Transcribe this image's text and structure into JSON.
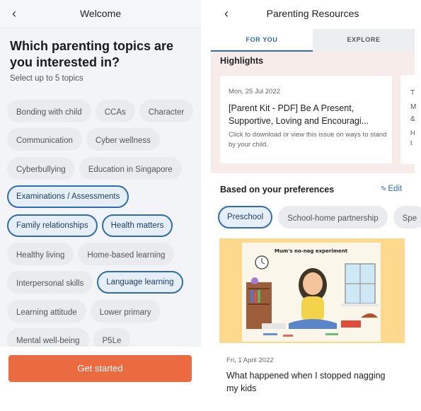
{
  "left": {
    "title": "Welcome",
    "heading": "Which parenting topics are you interested in?",
    "subheading": "Select up to 5 topics",
    "chip_rows": [
      [
        {
          "label": "Bonding with child",
          "selected": false
        },
        {
          "label": "CCAs",
          "selected": false
        },
        {
          "label": "Character",
          "selected": false
        }
      ],
      [
        {
          "label": "Communication",
          "selected": false
        },
        {
          "label": "Cyber wellness",
          "selected": false
        }
      ],
      [
        {
          "label": "Cyberbullying",
          "selected": false
        },
        {
          "label": "Education in Singapore",
          "selected": false
        }
      ],
      [
        {
          "label": "Examinations / Assessments",
          "selected": true
        }
      ],
      [
        {
          "label": "Family relationships",
          "selected": true
        },
        {
          "label": "Health matters",
          "selected": true
        }
      ],
      [
        {
          "label": "Healthy living",
          "selected": false
        },
        {
          "label": "Home-based learning",
          "selected": false
        }
      ],
      [
        {
          "label": "Interpersonal skills",
          "selected": false
        },
        {
          "label": "Language learning",
          "selected": true
        }
      ],
      [
        {
          "label": "Learning attitude",
          "selected": false
        },
        {
          "label": "Lower primary",
          "selected": false
        }
      ],
      [
        {
          "label": "Mental well-being",
          "selected": false
        },
        {
          "label": "P5Le",
          "selected": false
        }
      ]
    ],
    "cta_label": "Get started"
  },
  "right": {
    "title": "Parenting Resources",
    "tabs": [
      {
        "label": "FOR YOU",
        "active": true
      },
      {
        "label": "EXPLORE",
        "active": false
      }
    ],
    "highlights_title": "Highlights",
    "highlight": {
      "date": "Mon, 25 Jul 2022",
      "headline": "[Parent Kit - PDF] Be A Present, Supportive, Loving and Encouragi...",
      "description": "Click to download or view this issue on ways to stand by your child."
    },
    "highlight_peek": [
      "T",
      "M",
      "&",
      "H",
      "t"
    ],
    "preferences_title": "Based on your preferences",
    "edit_label": "Edit",
    "pref_chips": [
      {
        "label": "Preschool",
        "selected": true
      },
      {
        "label": "School-home partnership",
        "selected": false
      },
      {
        "label": "Spe",
        "selected": false
      }
    ],
    "article": {
      "image_caption": "Mum's no-nag experiment",
      "date": "Fri, 1 April 2022",
      "headline": "What happened when I stopped nagging my kids"
    }
  },
  "colors": {
    "accent_blue": "#2f6db3",
    "cta_orange": "#ec6a3f",
    "highlight_bg": "#f8ecea",
    "image_bg": "#fcd98c"
  }
}
